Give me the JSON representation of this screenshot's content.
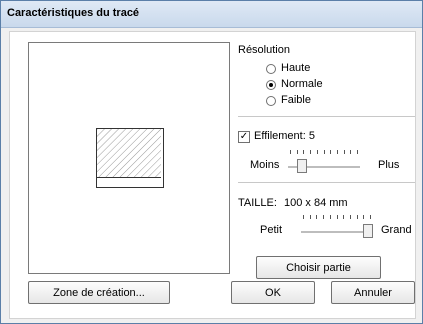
{
  "window": {
    "title": "Caractéristiques du tracé"
  },
  "resolution": {
    "label": "Résolution",
    "options": [
      {
        "label": "Haute",
        "selected": false
      },
      {
        "label": "Normale",
        "selected": true
      },
      {
        "label": "Faible",
        "selected": false
      }
    ]
  },
  "smoothing": {
    "checkbox_label": "Effilement: 5",
    "checked": true,
    "min_label": "Moins",
    "max_label": "Plus",
    "value_fraction": 0.15
  },
  "size": {
    "label": "TAILLE:",
    "value": "100 x 84 mm",
    "min_label": "Petit",
    "max_label": "Grand",
    "value_fraction": 1.0
  },
  "buttons": {
    "choose_part": "Choisir partie",
    "creation_zone": "Zone de création...",
    "ok": "OK",
    "cancel": "Annuler"
  }
}
